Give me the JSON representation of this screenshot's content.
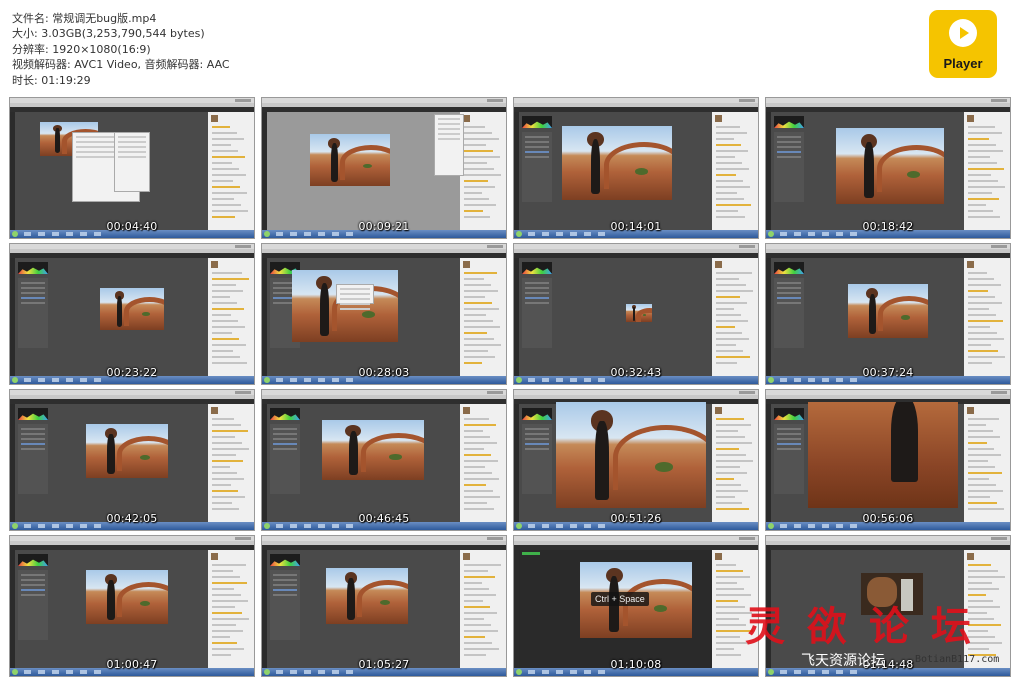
{
  "file_info": {
    "filename": "文件名: 常规调无bug版.mp4",
    "size": "大小: 3.03GB(3,253,790,544 bytes)",
    "resolution": "分辨率: 1920×1080(16:9)",
    "codecs": "视频解码器: AVC1 Video, 音频解码器: AAC",
    "duration": "时长: 01:19:29"
  },
  "player_logo": {
    "label": "Player",
    "color": "#f5c400",
    "icon": "play-icon"
  },
  "thumbnails": [
    {
      "timestamp": "00:04:40"
    },
    {
      "timestamp": "00:09:21"
    },
    {
      "timestamp": "00:14:01"
    },
    {
      "timestamp": "00:18:42"
    },
    {
      "timestamp": "00:23:22"
    },
    {
      "timestamp": "00:28:03"
    },
    {
      "timestamp": "00:32:43"
    },
    {
      "timestamp": "00:37:24"
    },
    {
      "timestamp": "00:42:05"
    },
    {
      "timestamp": "00:46:45"
    },
    {
      "timestamp": "00:51:26"
    },
    {
      "timestamp": "00:56:06"
    },
    {
      "timestamp": "01:00:47"
    },
    {
      "timestamp": "01:05:27"
    },
    {
      "timestamp": "01:10:08",
      "overlay": "Ctrl + Space"
    },
    {
      "timestamp": "01:14:48"
    }
  ],
  "watermark": {
    "chinese": "灵欲论坛",
    "site_name": "飞天资源论坛",
    "url": "BotianB117.com"
  }
}
